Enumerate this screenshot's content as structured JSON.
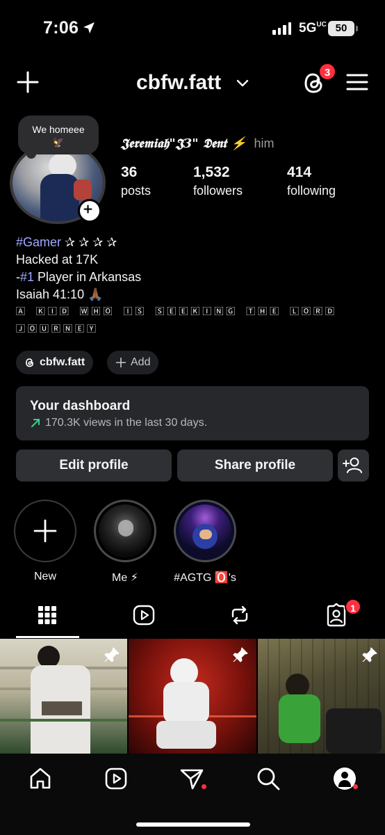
{
  "status": {
    "time": "7:06",
    "network": "5G",
    "network_suffix": "UC",
    "battery": "50"
  },
  "header": {
    "username": "cbfw.fatt",
    "notifications_badge": "3"
  },
  "note": {
    "text": "We homeee",
    "emoji": "🦅"
  },
  "profile": {
    "display_name": "𝕵𝖊𝖗𝖊𝖒𝖎𝖆𝖍\"𝕵3\" 𝕯𝖊𝖓𝖙 ⚡",
    "pronouns": "him",
    "stats": [
      {
        "value": "36",
        "label": "posts"
      },
      {
        "value": "1,532",
        "label": "followers"
      },
      {
        "value": "414",
        "label": "following"
      }
    ]
  },
  "bio": {
    "line1_tag": "#Gamer",
    "line1_rest": " ✰ ✰ ✰ ✰",
    "line2": "Hacked at 17K",
    "line3_prefix": "-",
    "line3_tag": "#1",
    "line3_rest": " Player in Arkansas",
    "line4": "Isaiah 41:10 🙏🏾",
    "line5": "🄰 🄺🄸🄳 🅆🄷🄾 🄸🅂 🅂🄴🄴🄺🄸🄽🄶 🅃🄷🄴 🄻🄾🅁🄳",
    "line6": "🄹🄾🅄🅁🄽🄴🅈"
  },
  "chips": {
    "threads_handle": "cbfw.fatt",
    "add_label": "Add"
  },
  "dashboard": {
    "title": "Your dashboard",
    "subtitle": "170.3K views in the last 30 days."
  },
  "buttons": {
    "edit": "Edit profile",
    "share": "Share profile"
  },
  "highlights": [
    {
      "label": "New"
    },
    {
      "label": "Me ⚡"
    },
    {
      "label": "#AGTG 🅾️'s"
    }
  ],
  "tabs": {
    "tagged_badge": "1"
  },
  "colors": {
    "accent_badge": "#ff3040",
    "hashtag": "#a0a8ff",
    "surface": "#27282c",
    "button": "#2f3034",
    "trend": "#3fd28a"
  }
}
